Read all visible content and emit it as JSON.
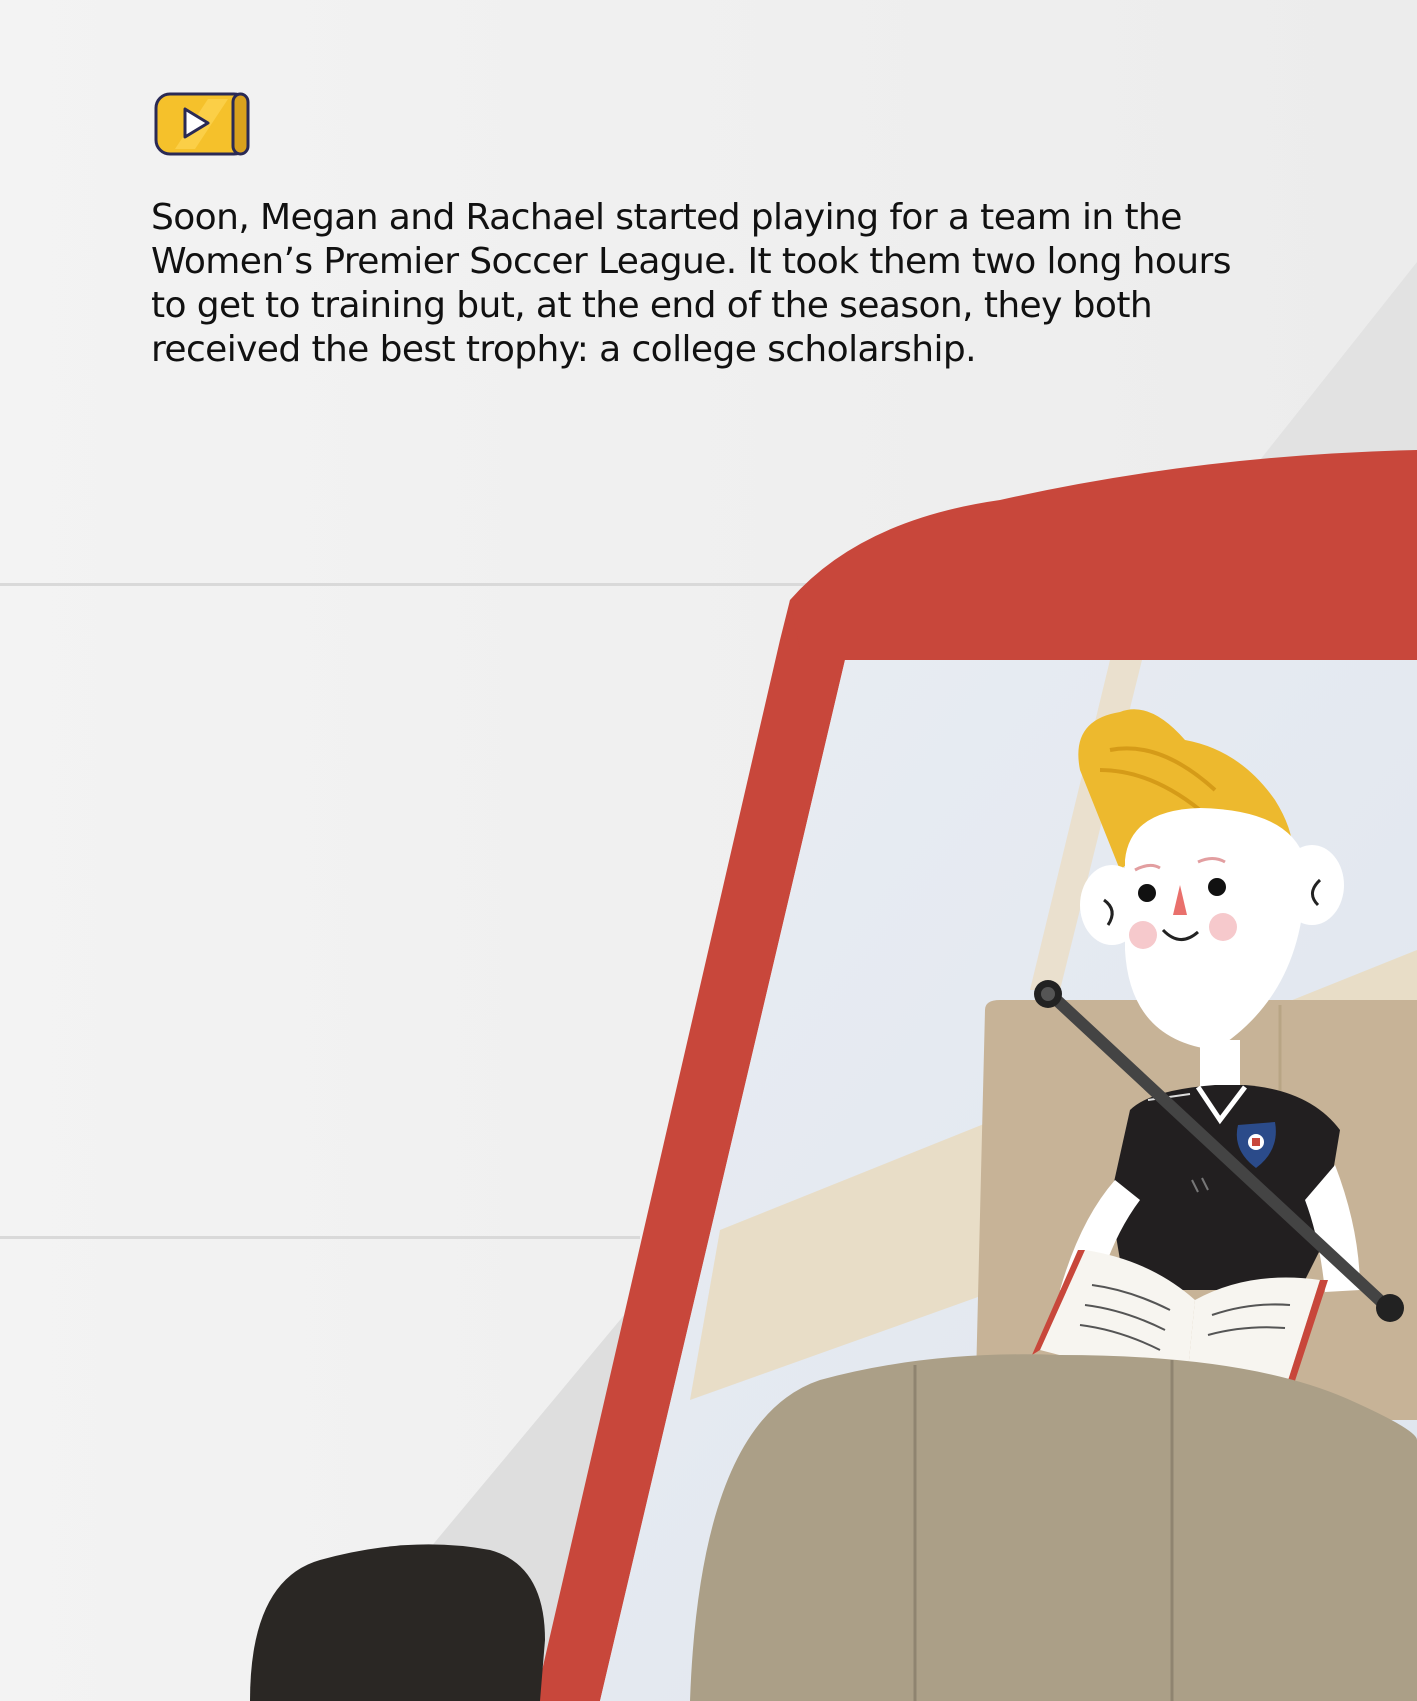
{
  "player": {
    "play_icon": "play-icon",
    "accent_color": "#F5C12B"
  },
  "story": {
    "paragraph": "Soon, Megan and Rachael started playing for a team in the Women’s Premier Soccer League. It took them two long hours to get to training but, at the end of the season, they both received the best trophy: a college scholarship."
  },
  "colors": {
    "background": "#F2F2F2",
    "car_red": "#C8473B",
    "seat_tan": "#C7B397",
    "hair_yellow": "#EDB92E",
    "jersey_black": "#221F20"
  }
}
